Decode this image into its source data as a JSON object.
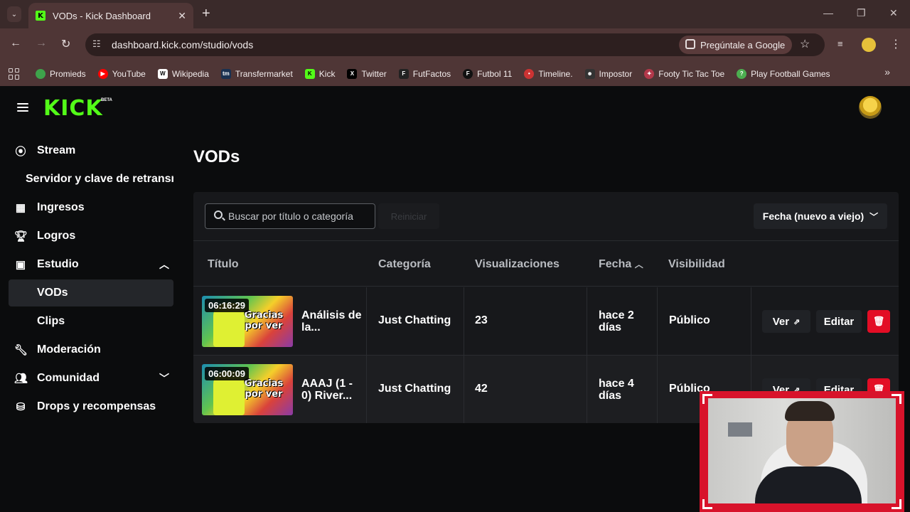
{
  "browser": {
    "tab_title": "VODs - Kick Dashboard",
    "url": "dashboard.kick.com/studio/vods",
    "ask_google": "Pregúntale a Google",
    "bookmarks": [
      "Promieds",
      "YouTube",
      "Wikipedia",
      "Transfermarket",
      "Kick",
      "Twitter",
      "FutFactos",
      "Futbol 11",
      "Timeline.",
      "Impostor",
      "Footy Tic Tac Toe",
      "Play Football Games"
    ]
  },
  "header": {
    "logo": "KICK",
    "logo_badge": "BETA"
  },
  "sidebar": {
    "items": [
      {
        "label": "Stream",
        "icon": "broadcast-icon"
      },
      {
        "label": "Servidor y clave de retransm",
        "icon": ""
      },
      {
        "label": "Ingresos",
        "icon": "chart-icon"
      },
      {
        "label": "Logros",
        "icon": "trophy-icon"
      },
      {
        "label": "Estudio",
        "icon": "film-icon"
      },
      {
        "label": "VODs",
        "icon": ""
      },
      {
        "label": "Clips",
        "icon": ""
      },
      {
        "label": "Moderación",
        "icon": "wrench-icon"
      },
      {
        "label": "Comunidad",
        "icon": "people-icon"
      },
      {
        "label": "Drops y recompensas",
        "icon": "gift-icon"
      }
    ]
  },
  "main": {
    "title": "VODs",
    "search_placeholder": "Buscar por título o categoría",
    "reset_label": "Reiniciar",
    "sort_label": "Fecha (nuevo a viejo)",
    "columns": [
      "Título",
      "Categoría",
      "Visualizaciones",
      "Fecha",
      "Visibilidad"
    ],
    "rows": [
      {
        "duration": "06:16:29",
        "thumb_text": "Gracias por ver",
        "title": "Análisis de la...",
        "category": "Just Chatting",
        "views": "23",
        "date": "hace 2 días",
        "visibility": "Público"
      },
      {
        "duration": "06:00:09",
        "thumb_text": "Gracias por ver",
        "title": "AAAJ (1 - 0) River...",
        "category": "Just Chatting",
        "views": "42",
        "date": "hace 4 días",
        "visibility": "Público"
      }
    ],
    "view_label": "Ver",
    "edit_label": "Editar"
  },
  "colors": {
    "brand": "#53fc18",
    "danger": "#e30d25",
    "background": "#0b0c0d",
    "chrome": "#4f3636"
  }
}
